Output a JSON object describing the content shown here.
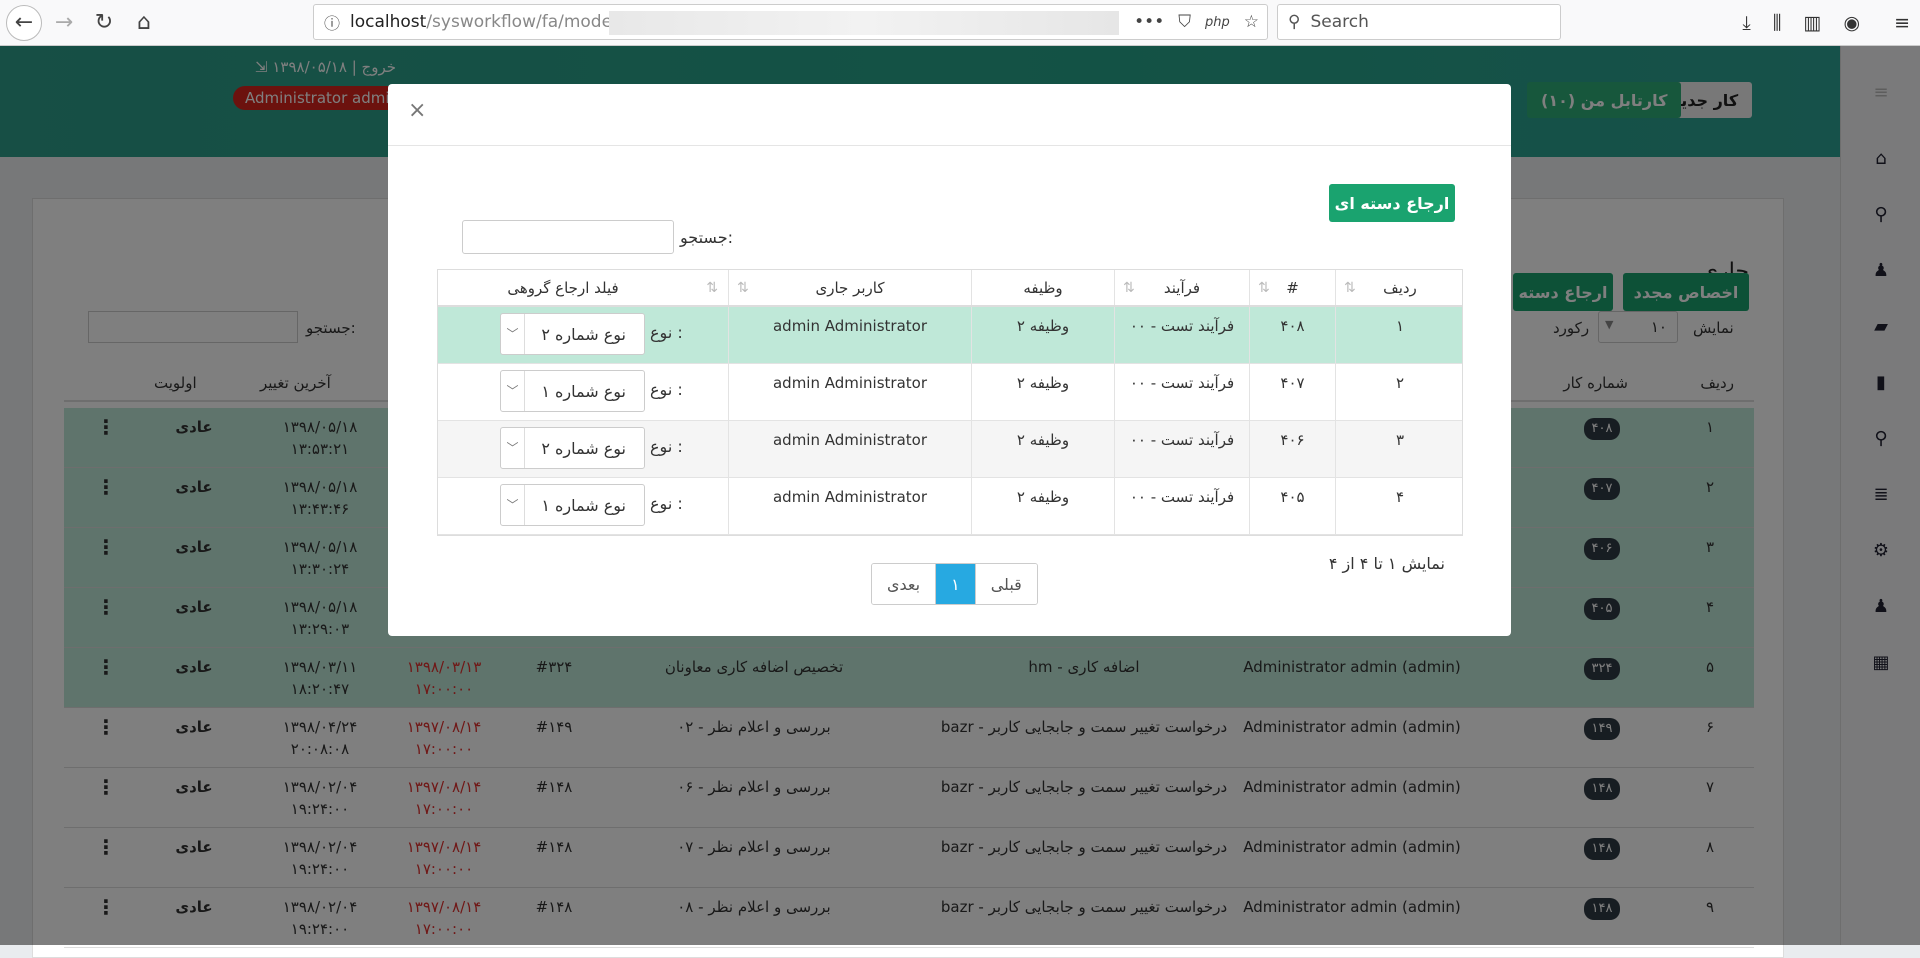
{
  "browser": {
    "url_host": "localhost",
    "url_path": "/sysworkflow/fa/modern",
    "search_placeholder": "Search",
    "php_label": "php",
    "more_label": "•••"
  },
  "header": {
    "user_line": "۱۳۹۸/۰۵/۱۸ | خروج",
    "user_badge": "Administrator admin",
    "new_work": "کار جدید",
    "my_cartable": "کارتابل من (۱۰)"
  },
  "page": {
    "title": "جاری",
    "reassign": "اخصاص مجدد",
    "batch_route": "ارجاع دسته",
    "show_label": "نمایش",
    "show_value": "۱۰",
    "record_label": "رکورد",
    "search_label": "جستجو:",
    "columns": {
      "row": "ردیف",
      "case_no": "شماره کار",
      "last_change": "آخرین تغییر",
      "priority": "اولویت"
    },
    "rows": [
      {
        "idx": "۱",
        "case": "۴۰۸",
        "date1": "۱۳۹۸/۰۵/۱۸",
        "date2": "۱۳:۵۳:۲۱",
        "prio": "عادی",
        "hl": true
      },
      {
        "idx": "۲",
        "case": "۴۰۷",
        "date1": "۱۳۹۸/۰۵/۱۸",
        "date2": "۱۳:۴۳:۴۶",
        "prio": "عادی",
        "hl": true
      },
      {
        "idx": "۳",
        "case": "۴۰۶",
        "date1": "۱۳۹۸/۰۵/۱۸",
        "date2": "۱۳:۳۰:۲۴",
        "prio": "عادی",
        "hl": true
      },
      {
        "idx": "۴",
        "case": "۴۰۵",
        "date1": "۱۳۹۸/۰۵/۱۸",
        "date2": "۱۳:۲۹:۰۳",
        "prio": "عادی",
        "hl": true
      },
      {
        "idx": "۵",
        "case": "۳۲۴",
        "user": "Administrator admin (admin)",
        "process": "hm - اضافه کاری",
        "task": "تخصیص اضافه کاری معاونان",
        "num": "#۳۲۴",
        "due1": "۱۳۹۸/۰۳/۱۳",
        "due2": "۱۷:۰۰:۰۰",
        "date1": "۱۳۹۸/۰۳/۱۱",
        "date2": "۱۸:۲۰:۴۷",
        "prio": "عادی",
        "hl": true
      },
      {
        "idx": "۶",
        "case": "۱۴۹",
        "user": "Administrator admin (admin)",
        "process": "bazr - درخواست تغییر سمت و جابجایی کاربر",
        "task": "۰۲ - بررسی و اعلام نظر",
        "num": "#۱۴۹",
        "due1": "۱۳۹۷/۰۸/۱۴",
        "due2": "۱۷:۰۰:۰۰",
        "date1": "۱۳۹۸/۰۴/۲۴",
        "date2": "۲۰:۰۸:۰۸",
        "prio": "عادی",
        "hl": false
      },
      {
        "idx": "۷",
        "case": "۱۴۸",
        "user": "Administrator admin (admin)",
        "process": "bazr - درخواست تغییر سمت و جابجایی کاربر",
        "task": "۰۶ - بررسی و اعلام نظر",
        "num": "#۱۴۸",
        "due1": "۱۳۹۷/۰۸/۱۴",
        "due2": "۱۷:۰۰:۰۰",
        "date1": "۱۳۹۸/۰۲/۰۴",
        "date2": "۱۹:۲۴:۰۰",
        "prio": "عادی",
        "hl": false
      },
      {
        "idx": "۸",
        "case": "۱۴۸",
        "user": "Administrator admin (admin)",
        "process": "bazr - درخواست تغییر سمت و جابجایی کاربر",
        "task": "۰۷ - بررسی و اعلام نظر",
        "num": "#۱۴۸",
        "due1": "۱۳۹۷/۰۸/۱۴",
        "due2": "۱۷:۰۰:۰۰",
        "date1": "۱۳۹۸/۰۲/۰۴",
        "date2": "۱۹:۲۴:۰۰",
        "prio": "عادی",
        "hl": false
      },
      {
        "idx": "۹",
        "case": "۱۴۸",
        "user": "Administrator admin (admin)",
        "process": "bazr - درخواست تغییر سمت و جابجایی کاربر",
        "task": "۰۸ - بررسی و اعلام نظر",
        "num": "#۱۴۸",
        "due1": "۱۳۹۷/۰۸/۱۴",
        "due2": "۱۷:۰۰:۰۰",
        "date1": "۱۳۹۸/۰۲/۰۴",
        "date2": "۱۹:۲۴:۰۰",
        "prio": "عادی",
        "hl": false
      }
    ]
  },
  "modal": {
    "close": "×",
    "batch_button": "ارجاع دسته ای",
    "search_label": "جستجو:",
    "columns": {
      "row": "ردیف",
      "num": "#",
      "process": "فرآیند",
      "task": "وظیفه",
      "user": "کاربر جاری",
      "group_field": "فیلد ارجاع گروهی"
    },
    "type_label": "نوع :",
    "rows": [
      {
        "row": "۱",
        "num": "۴۰۸",
        "process": "۰۰ - فرآیند تست",
        "task": "وظیفه ۲",
        "user": "admin Administrator",
        "type": "نوع شماره ۲"
      },
      {
        "row": "۲",
        "num": "۴۰۷",
        "process": "۰۰ - فرآیند تست",
        "task": "وظیفه ۲",
        "user": "admin Administrator",
        "type": "نوع شماره ۱"
      },
      {
        "row": "۳",
        "num": "۴۰۶",
        "process": "۰۰ - فرآیند تست",
        "task": "وظیفه ۲",
        "user": "admin Administrator",
        "type": "نوع شماره ۲"
      },
      {
        "row": "۴",
        "num": "۴۰۵",
        "process": "۰۰ - فرآیند تست",
        "task": "وظیفه ۲",
        "user": "admin Administrator",
        "type": "نوع شماره ۱"
      }
    ],
    "pagination": {
      "prev": "قبلی",
      "current": "۱",
      "next": "بعدی"
    },
    "info": "نمایش ۱ تا ۴ از ۴"
  }
}
